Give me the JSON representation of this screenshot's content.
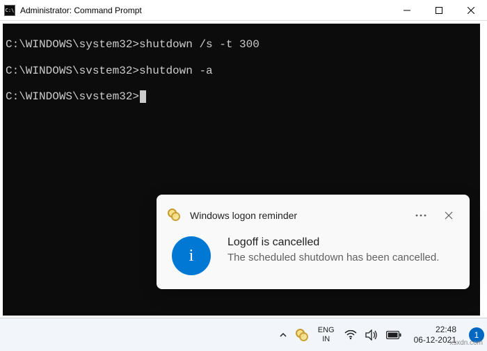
{
  "window": {
    "title": "Administrator: Command Prompt",
    "icon": "cmd-icon"
  },
  "terminal": {
    "prompt": "C:\\WINDOWS\\system32>",
    "lines": [
      {
        "prompt": "C:\\WINDOWS\\system32>",
        "cmd": "shutdown /s -t 300"
      },
      {
        "prompt": "C:\\WINDOWS\\svstem32>",
        "cmd": "shutdown -a"
      },
      {
        "prompt": "C:\\WINDOWS\\svstem32>",
        "cmd": ""
      }
    ]
  },
  "toast": {
    "app_name": "Windows logon reminder",
    "title": "Logoff is cancelled",
    "body": "The scheduled shutdown has been cancelled.",
    "info_glyph": "i"
  },
  "taskbar": {
    "lang_top": "ENG",
    "lang_bottom": "IN",
    "time": "22:48",
    "date": "06-12-2021",
    "notif_count": "1"
  },
  "watermark": "xsxdn.com"
}
